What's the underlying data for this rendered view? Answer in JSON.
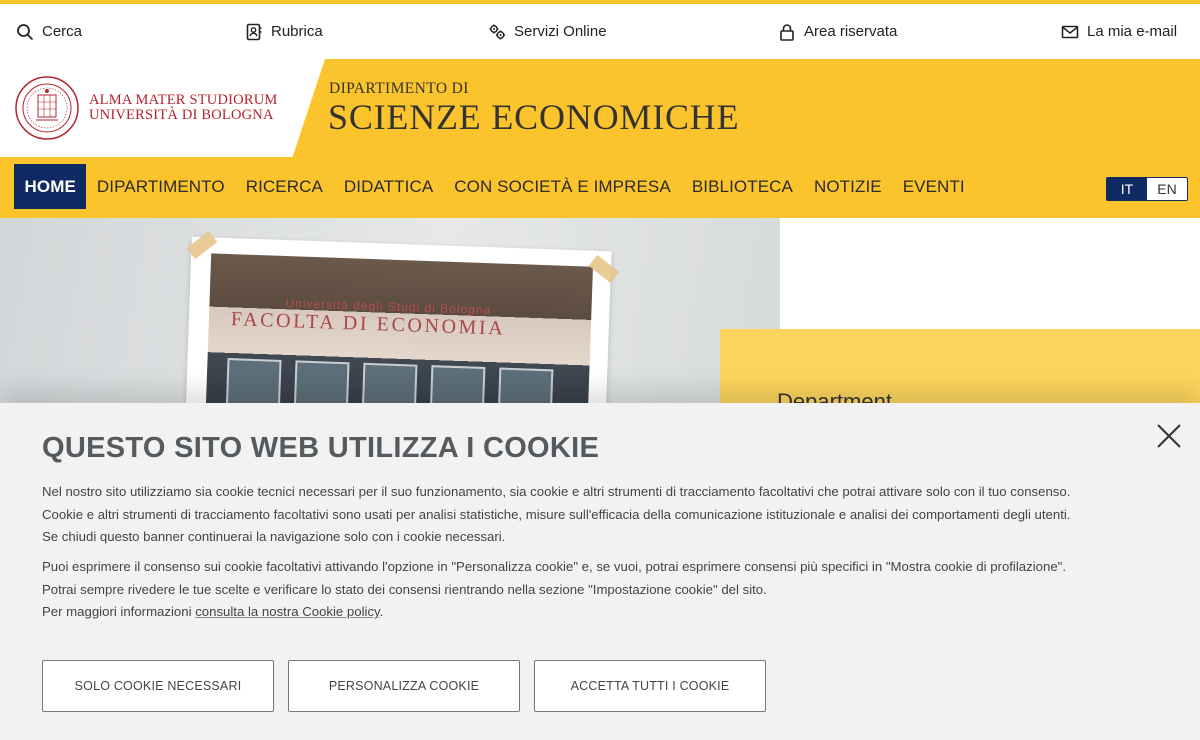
{
  "utility": {
    "search": "Cerca",
    "directory": "Rubrica",
    "services": "Servizi Online",
    "reserved": "Area riservata",
    "email": "La mia e-mail"
  },
  "brand": {
    "university_line1": "ALMA MATER STUDIORUM",
    "university_line2": "UNIVERSITÀ DI BOLOGNA",
    "dept_prefix": "DIPARTIMENTO DI",
    "dept_name": "SCIENZE ECONOMICHE"
  },
  "nav": {
    "items": [
      {
        "label": "HOME"
      },
      {
        "label": "DIPARTIMENTO"
      },
      {
        "label": "RICERCA"
      },
      {
        "label": "DIDATTICA"
      },
      {
        "label": "CON SOCIETÀ E IMPRESA"
      },
      {
        "label": "BIBLIOTECA"
      },
      {
        "label": "NOTIZIE"
      },
      {
        "label": "EVENTI"
      }
    ]
  },
  "lang": {
    "it": "IT",
    "en": "EN"
  },
  "hero": {
    "photo_line1": "Università degli Studi di Bologna",
    "photo_line2": "FACOLTA DI ECONOMIA",
    "card_title": "Department"
  },
  "cookie": {
    "title": "QUESTO SITO WEB UTILIZZA I COOKIE",
    "p1": "Nel nostro sito utilizziamo sia cookie tecnici necessari per il suo funzionamento, sia cookie e altri strumenti di tracciamento facoltativi che potrai attivare solo con il tuo consenso.",
    "p2": "Cookie e altri strumenti di tracciamento facoltativi sono usati per analisi statistiche, misure sull'efficacia della comunicazione istituzionale e analisi dei comportamenti degli utenti.",
    "p3": "Se chiudi questo banner continuerai la navigazione solo con i cookie necessari.",
    "p4": "Puoi esprimere il consenso sui cookie facoltativi attivando l'opzione in \"Personalizza cookie\" e, se vuoi, potrai esprimere consensi più specifici in \"Mostra cookie di profilazione\".",
    "p5": "Potrai sempre rivedere le tue scelte e verificare lo stato dei consensi rientrando nella sezione \"Impostazione cookie\" del sito.",
    "p6_prefix": "Per maggiori informazioni ",
    "p6_link": "consulta la nostra Cookie policy",
    "p6_suffix": ".",
    "btn_necessary": "SOLO COOKIE NECESSARI",
    "btn_customize": "PERSONALIZZA COOKIE",
    "btn_accept": "ACCETTA TUTTI I COOKIE"
  },
  "colors": {
    "accent_yellow": "#fcc42c",
    "nav_active": "#0f2a62",
    "brand_red": "#b3252b"
  }
}
